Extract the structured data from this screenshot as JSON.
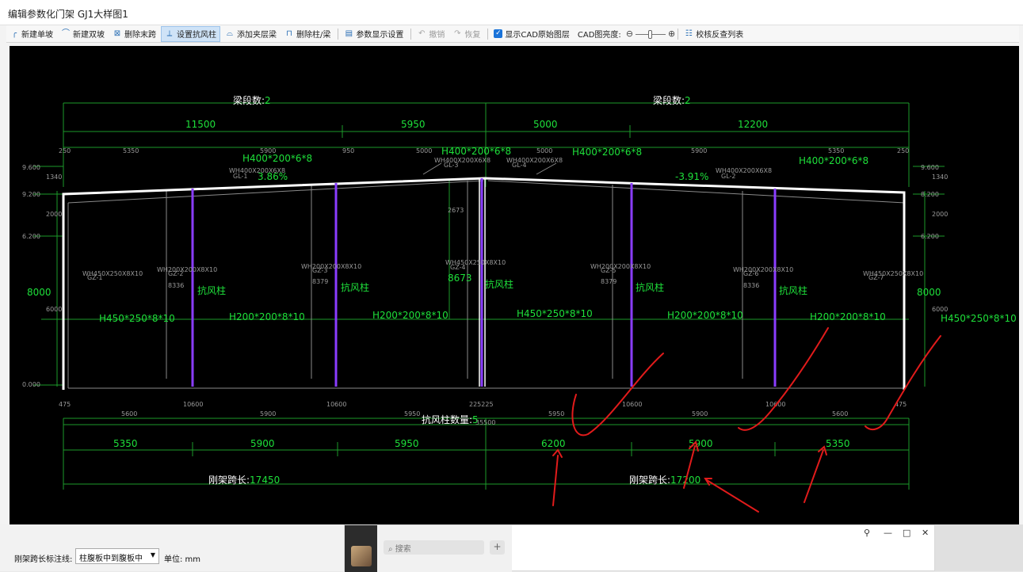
{
  "window": {
    "title": "编辑参数化门架 GJ1大样图1"
  },
  "toolbar": {
    "new_single_slope": "新建单坡",
    "new_double_slope": "新建双坡",
    "delete_last_span": "删除末跨",
    "set_wind_column": "设置抗风柱",
    "add_mezzanine_beam": "添加夹层梁",
    "delete_column_beam": "删除柱/梁",
    "param_display_settings": "参数显示设置",
    "undo": "撤销",
    "redo": "恢复",
    "show_cad_layer": "显示CAD原始图层",
    "cad_brightness": "CAD图亮度:",
    "check_list": "校核反查列表"
  },
  "drawing": {
    "segment_label": "梁段数:",
    "segment_left": "2",
    "segment_right": "2",
    "top_dims": [
      "11500",
      "5950",
      "5000",
      "12200"
    ],
    "small_top_dims": [
      "250",
      "5350",
      "5900",
      "950",
      "5000",
      "5000",
      "5900",
      "5350",
      "250"
    ],
    "beam_sections": [
      "H400*200*6*8",
      "H400*200*6*8",
      "H400*200*6*8",
      "H400*200*6*8"
    ],
    "beam_small_labels": [
      "WH400X200X6X8",
      "WH400X200X6X8",
      "WH400X200X6X8",
      "WH400X200X6X8"
    ],
    "beam_ids": [
      "GL-1",
      "GL-3",
      "GL-4",
      "GL-2"
    ],
    "slope_left": "3.86%",
    "slope_right": "-3.91%",
    "left_height": "8000",
    "right_height": "8000",
    "mid_height": "8673",
    "mid_small_height": "2673",
    "side_col_section": "H450*250*8*10",
    "side_col_small": "WH450X250X8X10",
    "side_col_ids": [
      "GZ-1",
      "GZ-7"
    ],
    "mid_col_small": "WH450X250X8X10",
    "mid_col_id": "GZ-4",
    "wind_col_label": "抗风柱",
    "wind_col_section": "H200*200*8*10",
    "wind_col_small": "WH200X200X8X10",
    "wind_col_small_heights": [
      "8336",
      "8379",
      "8379",
      "8336"
    ],
    "left_small_dims": [
      "9.600",
      "1340",
      "9.200",
      "2000",
      "6.200",
      "6000",
      "0.000"
    ],
    "right_small_dims": [
      "9.600",
      "1340",
      "8.200",
      "2000",
      "6.200",
      "6000"
    ],
    "bottom_small_dims": [
      "475",
      "5600",
      "10600",
      "5900",
      "10600",
      "5950",
      "225225",
      "5950",
      "10600",
      "5900",
      "10600",
      "5600",
      "475"
    ],
    "wind_col_count_label": "抗风柱数量:",
    "wind_col_count": "5",
    "bottom_small_total": "35500",
    "bottom_dims": [
      "5350",
      "5900",
      "5950",
      "6200",
      "5900",
      "5350"
    ],
    "span_label": "刚架跨长:",
    "span_left": "17450",
    "span_right": "17200",
    "col_small_ids": [
      "GZ-2",
      "GZ-3",
      "GZ-5",
      "GZ-6"
    ]
  },
  "bottom": {
    "span_line_label": "刚架跨长标注线:",
    "span_line_value": "柱腹板中到腹板中",
    "unit_label": "单位: mm"
  },
  "chat": {
    "search_placeholder": "搜索",
    "add": "+"
  },
  "colors": {
    "canvas_bg": "#000000",
    "green_text": "#1ee03a",
    "dim_line": "#1c9a2a",
    "purple_col": "#8a3dff",
    "frame": "#ffffff",
    "annotation": "#e11b1b"
  }
}
